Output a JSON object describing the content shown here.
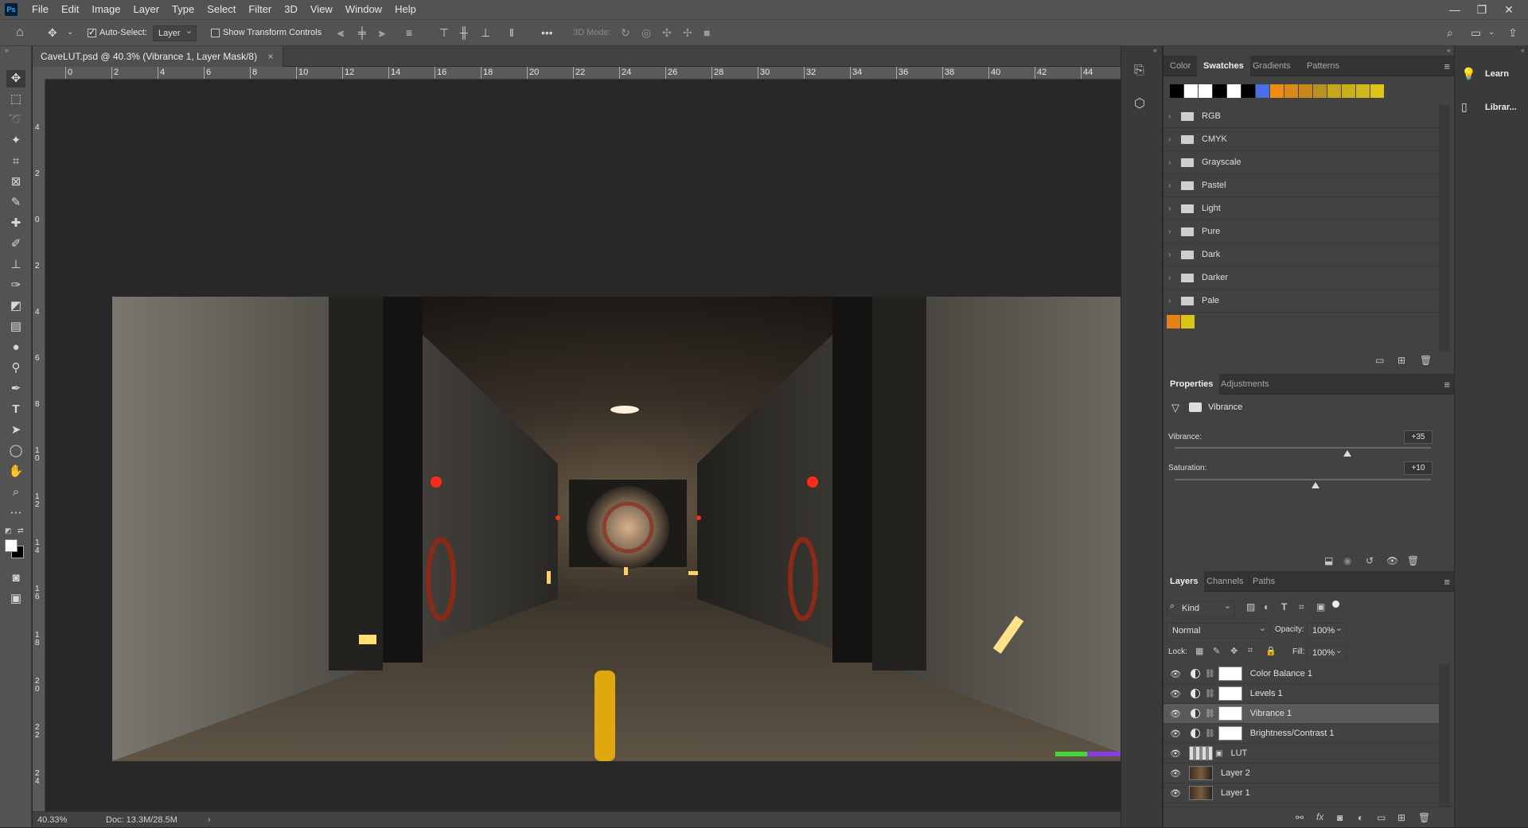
{
  "app": {
    "logo": "Ps"
  },
  "menu": [
    "File",
    "Edit",
    "Image",
    "Layer",
    "Type",
    "Select",
    "Filter",
    "3D",
    "View",
    "Window",
    "Help"
  ],
  "window_controls": {
    "minimize": "—",
    "restore": "❐",
    "close": "✕"
  },
  "options_bar": {
    "auto_select_label": "Auto-Select:",
    "auto_select_checked": true,
    "auto_select_target": "Layer",
    "show_transform_label": "Show Transform Controls",
    "show_transform_checked": false,
    "more": "•••",
    "mode_3d_label": "3D Mode:"
  },
  "document": {
    "tab_title": "CaveLUT.psd @ 40.3% (Vibrance 1, Layer Mask/8)",
    "close": "×",
    "zoom": "40.33%",
    "doc_size": "Doc: 13.3M/28.5M"
  },
  "rulers": {
    "h_ticks": [
      "0",
      "2",
      "4",
      "6",
      "8",
      "10",
      "12",
      "14",
      "16",
      "18",
      "20",
      "22",
      "24",
      "26",
      "28",
      "30",
      "32",
      "34",
      "36",
      "38",
      "40",
      "42",
      "44"
    ],
    "v_ticks": [
      "4",
      "2",
      "0",
      "2",
      "4",
      "6",
      "8",
      "10",
      "12",
      "14",
      "16",
      "18",
      "20",
      "22",
      "24"
    ]
  },
  "swatches_panel": {
    "tabs": [
      "Color",
      "Swatches",
      "Gradients",
      "Patterns"
    ],
    "active_tab": "Swatches",
    "recent_colors": [
      "#000000",
      "#ffffff",
      "#ffffff",
      "#000000",
      "#ffffff",
      "#000000",
      "#4b6ee8",
      "#ef8c14",
      "#d9881a",
      "#c8881e",
      "#b89024",
      "#c9a619",
      "#c7b01a",
      "#d2b81a",
      "#dcc418"
    ],
    "folders": [
      "RGB",
      "CMYK",
      "Grayscale",
      "Pastel",
      "Light",
      "Pure",
      "Dark",
      "Darker",
      "Pale"
    ],
    "custom_colors": [
      "#e8801a",
      "#d9c41a"
    ]
  },
  "properties_panel": {
    "tabs": [
      "Properties",
      "Adjustments"
    ],
    "active_tab": "Properties",
    "title": "Vibrance",
    "vibrance_label": "Vibrance:",
    "vibrance_value": "+35",
    "vibrance_level": 0.675,
    "saturation_label": "Saturation:",
    "saturation_value": "+10",
    "saturation_level": 0.55
  },
  "layers_panel": {
    "tabs": [
      "Layers",
      "Channels",
      "Paths"
    ],
    "active_tab": "Layers",
    "filter_label": "Kind",
    "blend_mode": "Normal",
    "opacity_label": "Opacity:",
    "opacity_value": "100%",
    "lock_label": "Lock:",
    "fill_label": "Fill:",
    "fill_value": "100%",
    "layers": [
      {
        "name": "Color Balance 1",
        "type": "adjustment",
        "selected": false
      },
      {
        "name": "Levels 1",
        "type": "adjustment",
        "selected": false
      },
      {
        "name": "Vibrance 1",
        "type": "adjustment",
        "selected": true
      },
      {
        "name": "Brightness/Contrast 1",
        "type": "adjustment",
        "selected": false
      },
      {
        "name": "LUT",
        "type": "lut",
        "selected": false
      },
      {
        "name": "Layer 2",
        "type": "image",
        "selected": false
      },
      {
        "name": "Layer 1",
        "type": "image",
        "selected": false
      }
    ]
  },
  "right_strip": {
    "learn": "Learn",
    "libraries": "Librar..."
  }
}
